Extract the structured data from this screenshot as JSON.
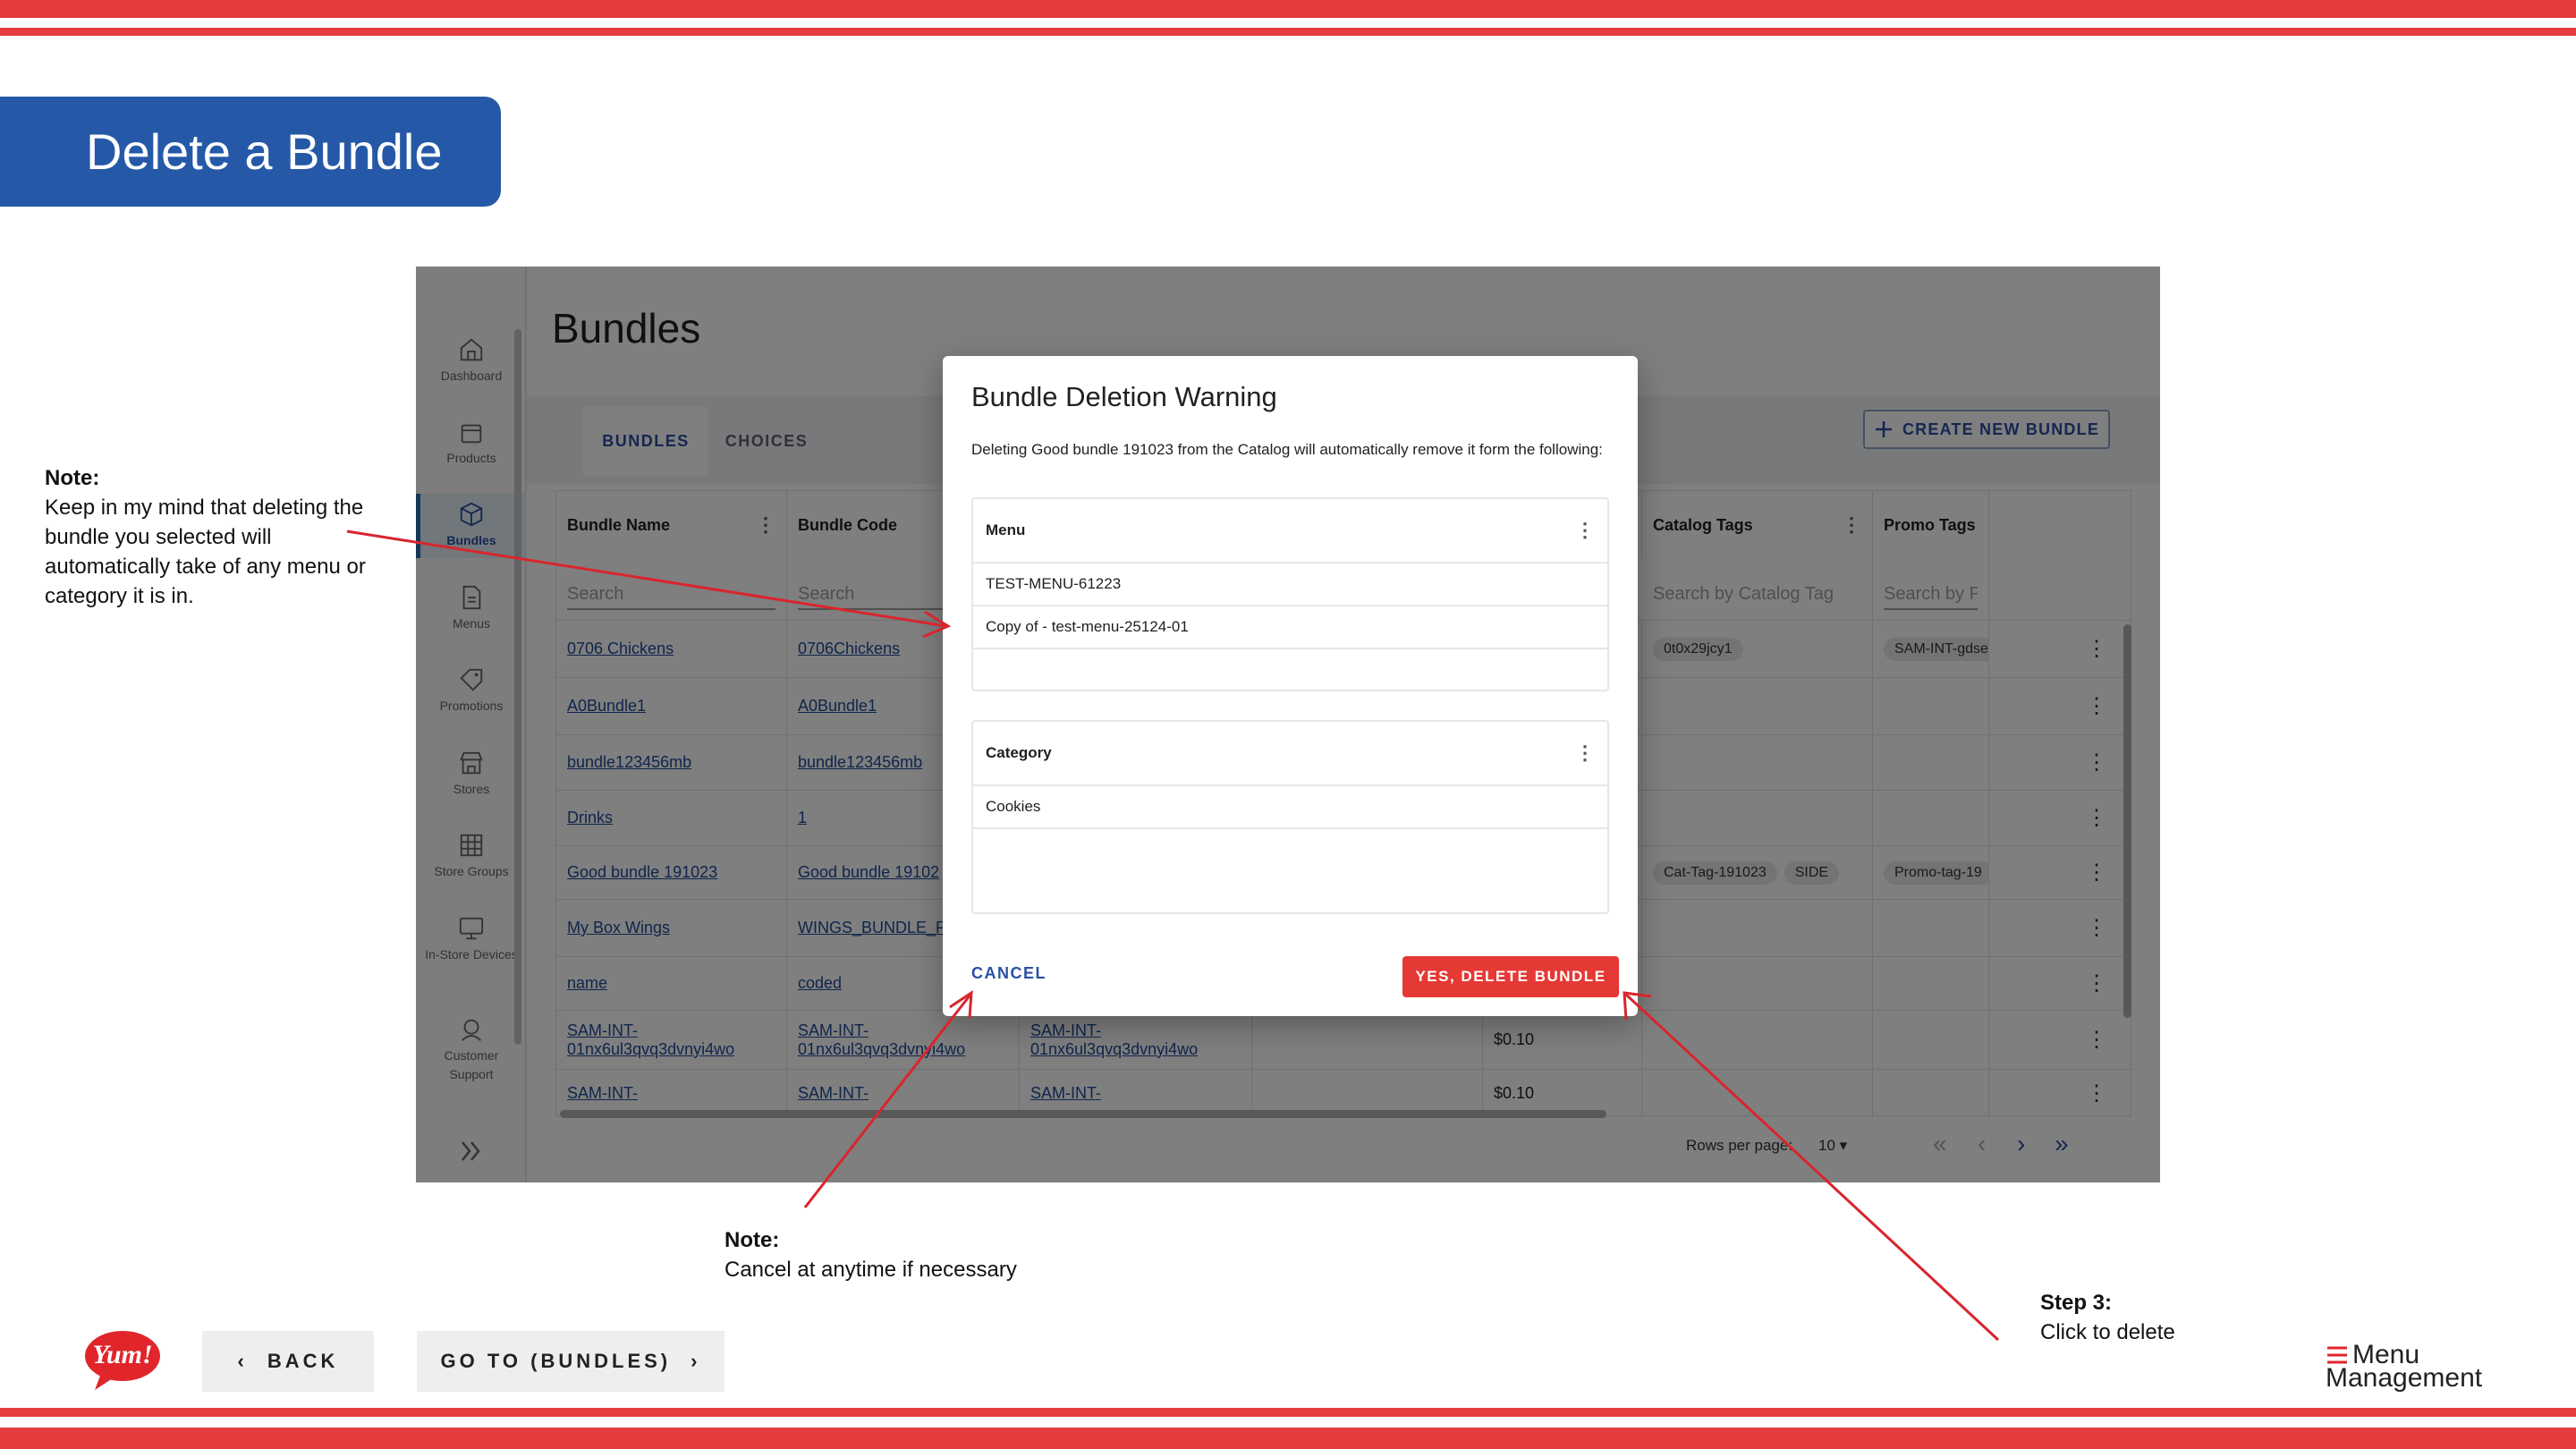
{
  "slide": {
    "title": "Delete a Bundle",
    "back_label": "BACK",
    "go_to_label": "GO TO (BUNDLES)",
    "brand_left": "Yum!",
    "brand_right_line1": "Menu",
    "brand_right_line2": "Management"
  },
  "notes": {
    "left": {
      "heading": "Note:",
      "text": "Keep in my mind that deleting the bundle you selected will automatically take of any menu or category it is in."
    },
    "bottom": {
      "heading": "Note:",
      "text": "Cancel at anytime if necessary"
    },
    "step": {
      "heading": "Step 3:",
      "text": "Click to delete"
    }
  },
  "app": {
    "sidebar": [
      {
        "label": "Dashboard",
        "icon": "home-icon"
      },
      {
        "label": "Products",
        "icon": "bag-icon"
      },
      {
        "label": "Bundles",
        "icon": "cube-icon"
      },
      {
        "label": "Menus",
        "icon": "document-icon"
      },
      {
        "label": "Promotions",
        "icon": "tag-icon"
      },
      {
        "label": "Stores",
        "icon": "storefront-icon"
      },
      {
        "label": "Store Groups",
        "icon": "grid-icon"
      },
      {
        "label": "In-Store Devices",
        "icon": "monitor-icon"
      },
      {
        "label": "Customer Support",
        "icon": "support-icon"
      }
    ],
    "page_title": "Bundles",
    "tabs": [
      "BUNDLES",
      "CHOICES"
    ],
    "create_label": "CREATE NEW BUNDLE",
    "columns": [
      "Bundle Name",
      "Bundle Code",
      "Catalog Tags",
      "Promo Tags"
    ],
    "search_placeholders": [
      "Search",
      "Search",
      "Search by Catalog Tag",
      "Search by Pr"
    ],
    "rows": [
      {
        "name": "0706 Chickens",
        "code": "0706Chickens",
        "catalog_tags": [
          "0t0x29jcy1"
        ],
        "promo_tags": [
          "SAM-INT-gdse"
        ]
      },
      {
        "name": "A0Bundle1",
        "code": "A0Bundle1",
        "catalog_tags": [],
        "promo_tags": []
      },
      {
        "name": "bundle123456mb",
        "code": "bundle123456mb",
        "catalog_tags": [],
        "promo_tags": []
      },
      {
        "name": "Drinks",
        "code": "1",
        "catalog_tags": [],
        "promo_tags": []
      },
      {
        "name": "Good bundle 191023",
        "code": "Good bundle 19102",
        "catalog_tags": [
          "Cat-Tag-191023",
          "SIDE"
        ],
        "promo_tags": [
          "Promo-tag-19"
        ]
      },
      {
        "name": "My Box Wings",
        "code": "WINGS_BUNDLE_PI",
        "catalog_tags": [],
        "promo_tags": []
      },
      {
        "name": "name",
        "code": "coded",
        "catalog_tags": [],
        "promo_tags": []
      },
      {
        "name": "SAM-INT-01nx6ul3qvq3dvnyi4wo",
        "code": "SAM-INT-01nx6ul3qvq3dvnyi4wo",
        "extra": "SAM-INT-01nx6ul3qvq3dvnyi4wo",
        "price": "$0.10",
        "catalog_tags": [],
        "promo_tags": []
      },
      {
        "name": "SAM-INT-",
        "code": "SAM-INT-",
        "extra": "SAM-INT-",
        "price": "$0.10",
        "catalog_tags": [],
        "promo_tags": []
      }
    ],
    "pager": {
      "rows_per_page_label": "Rows per page:",
      "rows_per_page": "10"
    },
    "dialog": {
      "title": "Bundle Deletion Warning",
      "message": "Deleting Good bundle 191023 from the Catalog will automatically remove it form the following:",
      "menu_header": "Menu",
      "menus": [
        "TEST-MENU-61223",
        "Copy of - test-menu-25124-01"
      ],
      "category_header": "Category",
      "categories": [
        "Cookies"
      ],
      "cancel_label": "CANCEL",
      "confirm_label": "YES, DELETE BUNDLE"
    }
  },
  "colors": {
    "stripe": "#e53c3f",
    "banner": "#2559a7",
    "primary": "#2b4fa3",
    "danger": "#e53935"
  }
}
